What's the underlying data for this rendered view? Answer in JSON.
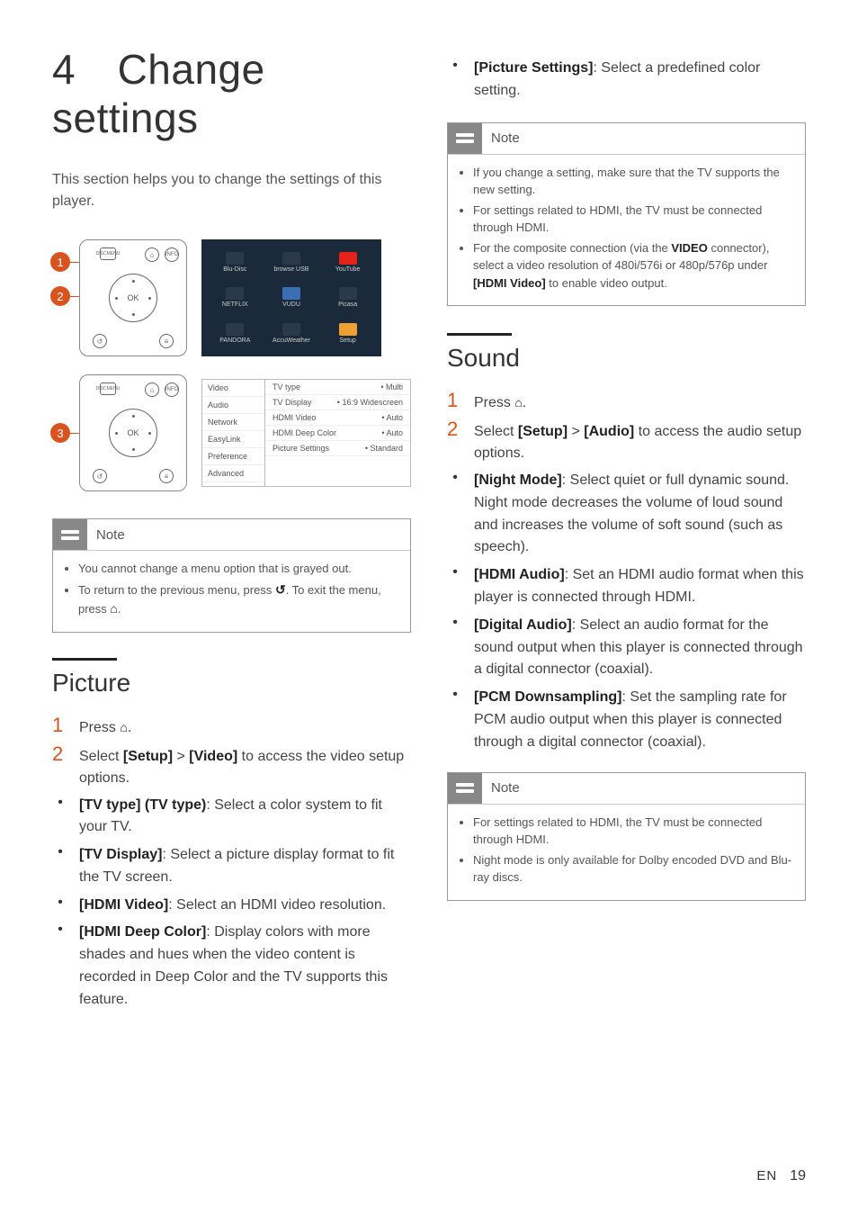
{
  "header": {
    "title": "4 Change settings"
  },
  "intro": "This section helps you to change the settings of this player.",
  "callouts": [
    "1",
    "2",
    "3"
  ],
  "tiles": {
    "items": [
      {
        "label": "Blu-Disc",
        "bg": "#2a3a4a"
      },
      {
        "label": "browse USB",
        "bg": "#2a3a4a"
      },
      {
        "label": "YouTube",
        "bg": "#e62117"
      },
      {
        "label": "NETFLIX",
        "bg": "#2a3a4a"
      },
      {
        "label": "VUDU",
        "bg": "#3b6fb5"
      },
      {
        "label": "Picasa",
        "bg": "#2a3a4a"
      },
      {
        "label": "PANDORA",
        "bg": "#2a3a4a"
      },
      {
        "label": "AccuWeather",
        "bg": "#2a3a4a"
      },
      {
        "label": "Setup",
        "bg": "#f0a030"
      }
    ]
  },
  "menu": {
    "left": [
      "Video",
      "Audio",
      "Network",
      "EasyLink",
      "Preference",
      "Advanced"
    ],
    "right": [
      {
        "k": "TV type",
        "v": "Multi"
      },
      {
        "k": "TV Display",
        "v": "16:9 Widescreen"
      },
      {
        "k": "HDMI Video",
        "v": "Auto"
      },
      {
        "k": "HDMI Deep Color",
        "v": "Auto"
      },
      {
        "k": "Picture Settings",
        "v": "Standard"
      }
    ]
  },
  "note1": {
    "title": "Note",
    "items": [
      "You cannot change a menu option that is grayed out.",
      {
        "pre": "To return to the previous menu, press ",
        "icon": "↺",
        "mid": ". To exit the menu, press ",
        "icon2": "⌂",
        "post": "."
      }
    ]
  },
  "picture": {
    "heading": "Picture",
    "steps": [
      {
        "n": "1",
        "pre": "Press ",
        "icon": "⌂",
        "post": "."
      },
      {
        "n": "2",
        "pre": "Select ",
        "b1": "[Setup]",
        "mid": " > ",
        "b2": "[Video]",
        "post": " to access the video setup options."
      }
    ],
    "bullets": [
      {
        "b": "[TV type] (TV type)",
        "t": ": Select a color system to fit your TV."
      },
      {
        "b": "[TV Display]",
        "t": ": Select a picture display format to fit the TV screen."
      },
      {
        "b": "[HDMI Video]",
        "t": ": Select an HDMI video resolution."
      },
      {
        "b": "[HDMI Deep Color]",
        "t": ": Display colors with more shades and hues when the video content is recorded in Deep Color and the TV supports this feature."
      },
      {
        "b": "[Picture Settings]",
        "t": ": Select a predefined color setting."
      }
    ]
  },
  "note2": {
    "title": "Note",
    "items": [
      "If you change a setting, make sure that the TV supports the new setting.",
      "For settings related to HDMI, the TV must be connected through HDMI.",
      {
        "pre": "For the composite connection (via the ",
        "b": "VIDEO",
        "mid": " connector), select a video resolution of 480i/576i or 480p/576p under ",
        "b2": "[HDMI Video]",
        "post": " to enable video output."
      }
    ]
  },
  "sound": {
    "heading": "Sound",
    "steps": [
      {
        "n": "1",
        "pre": "Press ",
        "icon": "⌂",
        "post": "."
      },
      {
        "n": "2",
        "pre": "Select ",
        "b1": "[Setup]",
        "mid": " > ",
        "b2": "[Audio]",
        "post": " to access the audio setup options."
      }
    ],
    "bullets": [
      {
        "b": "[Night Mode]",
        "t": ": Select quiet or full dynamic sound. Night mode decreases the volume of loud sound and increases the volume of soft sound (such as speech)."
      },
      {
        "b": "[HDMI Audio]",
        "t": ": Set an HDMI audio format when this player is connected through HDMI."
      },
      {
        "b": "[Digital Audio]",
        "t": ": Select an audio format for the sound output when this player is connected through a digital connector (coaxial)."
      },
      {
        "b": "[PCM Downsampling]",
        "t": ": Set the sampling rate for PCM audio output when this player is connected through a digital connector (coaxial)."
      }
    ]
  },
  "note3": {
    "title": "Note",
    "items": [
      "For settings related to HDMI, the TV must be connected through HDMI.",
      "Night mode is only available for Dolby encoded DVD and Blu-ray discs."
    ]
  },
  "footer": {
    "lang": "EN",
    "page": "19"
  }
}
